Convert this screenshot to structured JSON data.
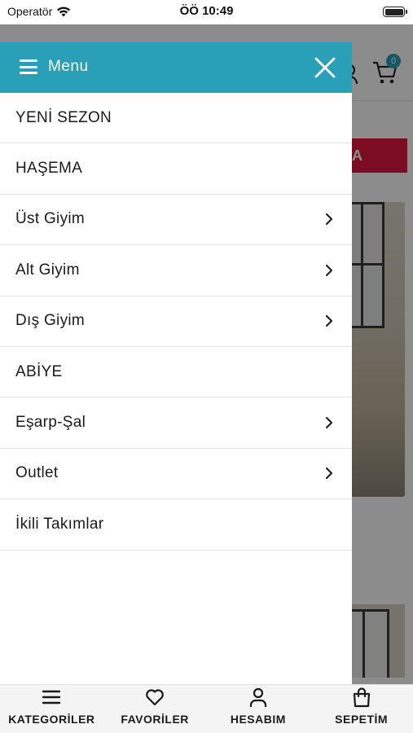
{
  "status_bar": {
    "carrier": "Operatör",
    "time": "ÖÖ 10:49"
  },
  "background": {
    "cart_badge": "0",
    "red_button_text": "A"
  },
  "drawer": {
    "title": "Menu",
    "items": [
      {
        "label": "YENİ SEZON",
        "has_submenu": false
      },
      {
        "label": "HAŞEMA",
        "has_submenu": false
      },
      {
        "label": "Üst Giyim",
        "has_submenu": true
      },
      {
        "label": "Alt Giyim",
        "has_submenu": true
      },
      {
        "label": "Dış Giyim",
        "has_submenu": true
      },
      {
        "label": "ABİYE",
        "has_submenu": false
      },
      {
        "label": "Eşarp-Şal",
        "has_submenu": true
      },
      {
        "label": "Outlet",
        "has_submenu": true
      },
      {
        "label": "İkili Takımlar",
        "has_submenu": false
      }
    ]
  },
  "tab_bar": {
    "tabs": [
      {
        "label": "KATEGORİLER",
        "icon": "list-icon"
      },
      {
        "label": "FAVORİLER",
        "icon": "heart-icon"
      },
      {
        "label": "HESABIM",
        "icon": "user-icon"
      },
      {
        "label": "SEPETİM",
        "icon": "bag-icon"
      }
    ]
  },
  "colors": {
    "accent": "#2aa0b8",
    "sale_red": "#e2163f"
  }
}
